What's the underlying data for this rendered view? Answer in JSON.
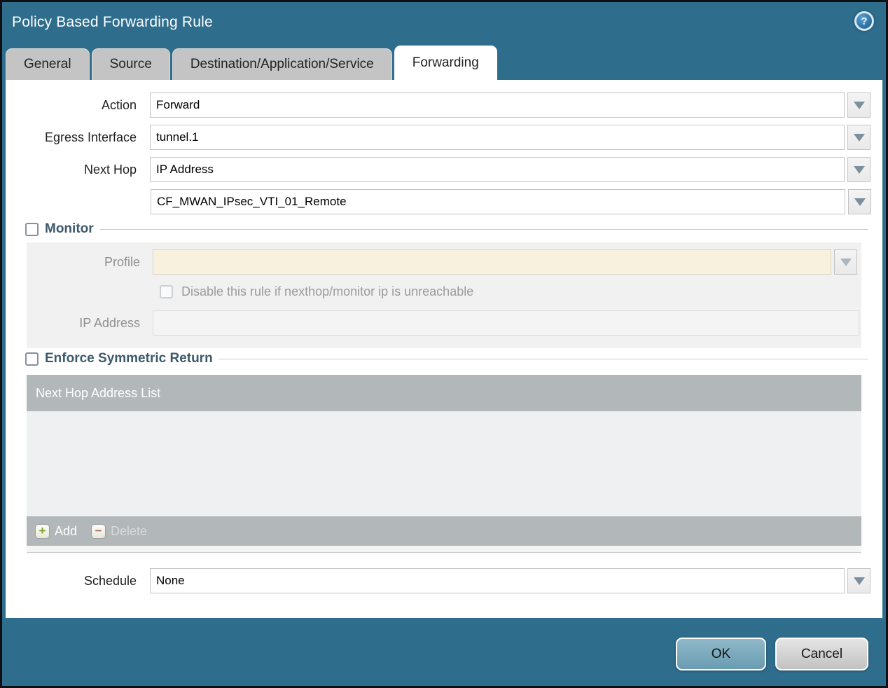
{
  "window": {
    "title": "Policy Based Forwarding Rule",
    "help_glyph": "?",
    "ok_label": "OK",
    "cancel_label": "Cancel"
  },
  "tabs": [
    {
      "label": "General",
      "active": false
    },
    {
      "label": "Source",
      "active": false
    },
    {
      "label": "Destination/Application/Service",
      "active": false
    },
    {
      "label": "Forwarding",
      "active": true
    }
  ],
  "form": {
    "action": {
      "label": "Action",
      "value": "Forward"
    },
    "egress_interface": {
      "label": "Egress Interface",
      "value": "tunnel.1"
    },
    "next_hop": {
      "label": "Next Hop",
      "value": "IP Address"
    },
    "next_hop_address": {
      "value": "CF_MWAN_IPsec_VTI_01_Remote"
    },
    "schedule": {
      "label": "Schedule",
      "value": "None"
    }
  },
  "monitor": {
    "title": "Monitor",
    "checked": false,
    "profile": {
      "label": "Profile",
      "value": ""
    },
    "disable_rule": {
      "label": "Disable this rule if nexthop/monitor ip is unreachable",
      "checked": false
    },
    "ip_address": {
      "label": "IP Address",
      "value": ""
    }
  },
  "symmetric_return": {
    "title": "Enforce Symmetric Return",
    "checked": false,
    "list_header": "Next Hop Address List",
    "rows": [],
    "add_label": "Add",
    "delete_label": "Delete",
    "add_icon": "+",
    "delete_icon": "−"
  },
  "colors": {
    "titlebar": "#2F6D8D",
    "active_tab": "#FFFFFF",
    "inactive_tab": "#C4C4C4",
    "section_title": "#3D5A6B",
    "list_header_bg": "#B2B7BA",
    "profile_field_bg": "#F7F1DE",
    "ok_button": "#7FADC0",
    "cancel_button": "#D3D3D3"
  }
}
